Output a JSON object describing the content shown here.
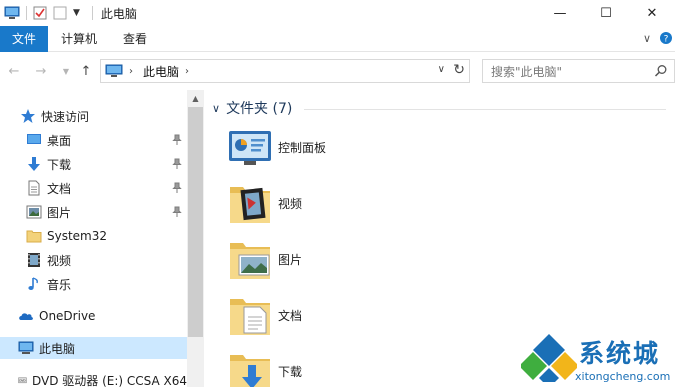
{
  "window": {
    "title": "此电脑",
    "minimize_glyph": "—",
    "maximize_glyph": "☐",
    "close_glyph": "✕"
  },
  "ribbon": {
    "tabs": [
      "文件",
      "计算机",
      "查看"
    ],
    "expand_glyph": "∨",
    "help_glyph": "?"
  },
  "address": {
    "path_label": "此电脑",
    "search_placeholder": "搜索\"此电脑\""
  },
  "nav": {
    "items": [
      {
        "label": "快速访问",
        "icon": "star-icon"
      },
      {
        "label": "桌面",
        "icon": "desktop-icon",
        "pinned": true
      },
      {
        "label": "下载",
        "icon": "download-icon",
        "pinned": true
      },
      {
        "label": "文档",
        "icon": "document-icon",
        "pinned": true
      },
      {
        "label": "图片",
        "icon": "picture-icon",
        "pinned": true
      },
      {
        "label": "System32",
        "icon": "folder-icon"
      },
      {
        "label": "视频",
        "icon": "video-icon"
      },
      {
        "label": "音乐",
        "icon": "music-icon"
      },
      {
        "label": "OneDrive",
        "icon": "cloud-icon"
      },
      {
        "label": "此电脑",
        "icon": "computer-icon",
        "selected": true
      },
      {
        "label": "DVD 驱动器 (E:) CCSA X64",
        "icon": "dvd-icon"
      }
    ]
  },
  "content": {
    "group_title": "文件夹 (7)",
    "items": [
      {
        "label": "控制面板",
        "icon": "control-panel-icon"
      },
      {
        "label": "视频",
        "icon": "video-folder-icon"
      },
      {
        "label": "图片",
        "icon": "pictures-folder-icon"
      },
      {
        "label": "文档",
        "icon": "documents-folder-icon"
      },
      {
        "label": "下载",
        "icon": "downloads-folder-icon"
      }
    ]
  },
  "watermark": {
    "text": "系统城",
    "url": "xitongcheng.com"
  },
  "colors": {
    "accent": "#1979ca",
    "selected": "#cce8ff",
    "group_title": "#1e395b",
    "folder": "#f3d27a"
  }
}
